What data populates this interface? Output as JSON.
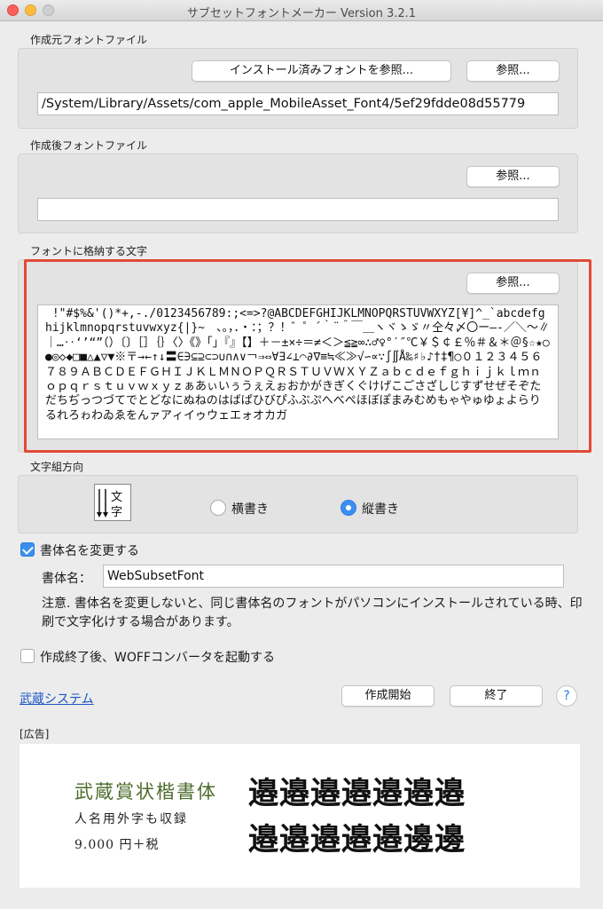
{
  "window": {
    "title": "サブセットフォントメーカー Version 3.2.1"
  },
  "source": {
    "label": "作成元フォントファイル",
    "installed_button": "インストール済みフォントを参照...",
    "browse_button": "参照...",
    "path": "/System/Library/Assets/com_apple_MobileAsset_Font4/5ef29fdde08d55779"
  },
  "output": {
    "label": "作成後フォントファイル",
    "browse_button": "参照...",
    "path": ""
  },
  "chars": {
    "label": "フォントに格納する文字",
    "browse_button": "参照...",
    "text": " !\"#$%&'()*+,-./0123456789:;<=>?@ABCDEFGHIJKLMNOPQRSTUVWXYZ[¥]^_`abcdefghijklmnopqrstuvwxyz{|}~　、。，．・：；？！゛゜´｀¨＾￣＿ヽヾゝゞ〃仝々〆〇ー―‐／＼～∥｜…‥‘’“”（）〔〕［］｛｝〈〉《》「」『』【】＋－±×÷＝≠＜＞≦≧∞∴♂♀°′″℃￥＄￠￡％＃＆＊＠§☆★○●◎◇◆□■△▲▽▼※〒→←↑↓〓∈∋⊆⊇⊂⊃∪∩∧∨￢⇒⇔∀∃∠⊥⌒∂∇≡≒≪≫√∽∝∵∫∬Å‰♯♭♪†‡¶◯０１２３４５６７８９ＡＢＣＤＥＦＧＨＩＪＫＬＭＮＯＰＱＲＳＴＵＶＷＸＹＺａｂｃｄｅｆｇｈｉｊｋｌｍｎｏｐｑｒｓｔｕｖｗｘｙｚぁあぃいぅうぇえぉおかがきぎくぐけげこごさざしじすずせぜそぞただちぢっつづてでとどなにぬねのはばぱひびぴふぶぷへべぺほぼぽまみむめもゃやゅゆょよらりるれろゎわゐゑをんァアィイゥウェエォオカガ"
  },
  "direction": {
    "label": "文字組方向",
    "icon": "vertical-writing-icon",
    "horizontal": "横書き",
    "vertical": "縦書き",
    "selected": "vertical"
  },
  "rename": {
    "checkbox_label": "書体名を変更する",
    "checked": true,
    "name_label": "書体名：",
    "name_value": "WebSubsetFont",
    "note": "注意. 書体名を変更しないと、同じ書体名のフォントがパソコンにインストールされている時、印刷で文字化けする場合があります。"
  },
  "woff": {
    "checkbox_label": "作成終了後、WOFFコンバータを起動する",
    "checked": false
  },
  "footer": {
    "link": "武蔵システム",
    "start_button": "作成開始",
    "quit_button": "終了",
    "help_button": "?"
  },
  "ad": {
    "label": "[広告]",
    "title": "武蔵賞状楷書体",
    "subtitle": "人名用外字も収録",
    "price": "9.000 円＋税",
    "glyph_row1": "邉邉邉邉邉邉邉",
    "glyph_row2": "邉邉邉邉邉邊邊"
  },
  "colors": {
    "accent": "#3b8ff0",
    "highlight": "#e04a35",
    "link": "#1a55c4",
    "ad_title": "#4d6b2c"
  }
}
